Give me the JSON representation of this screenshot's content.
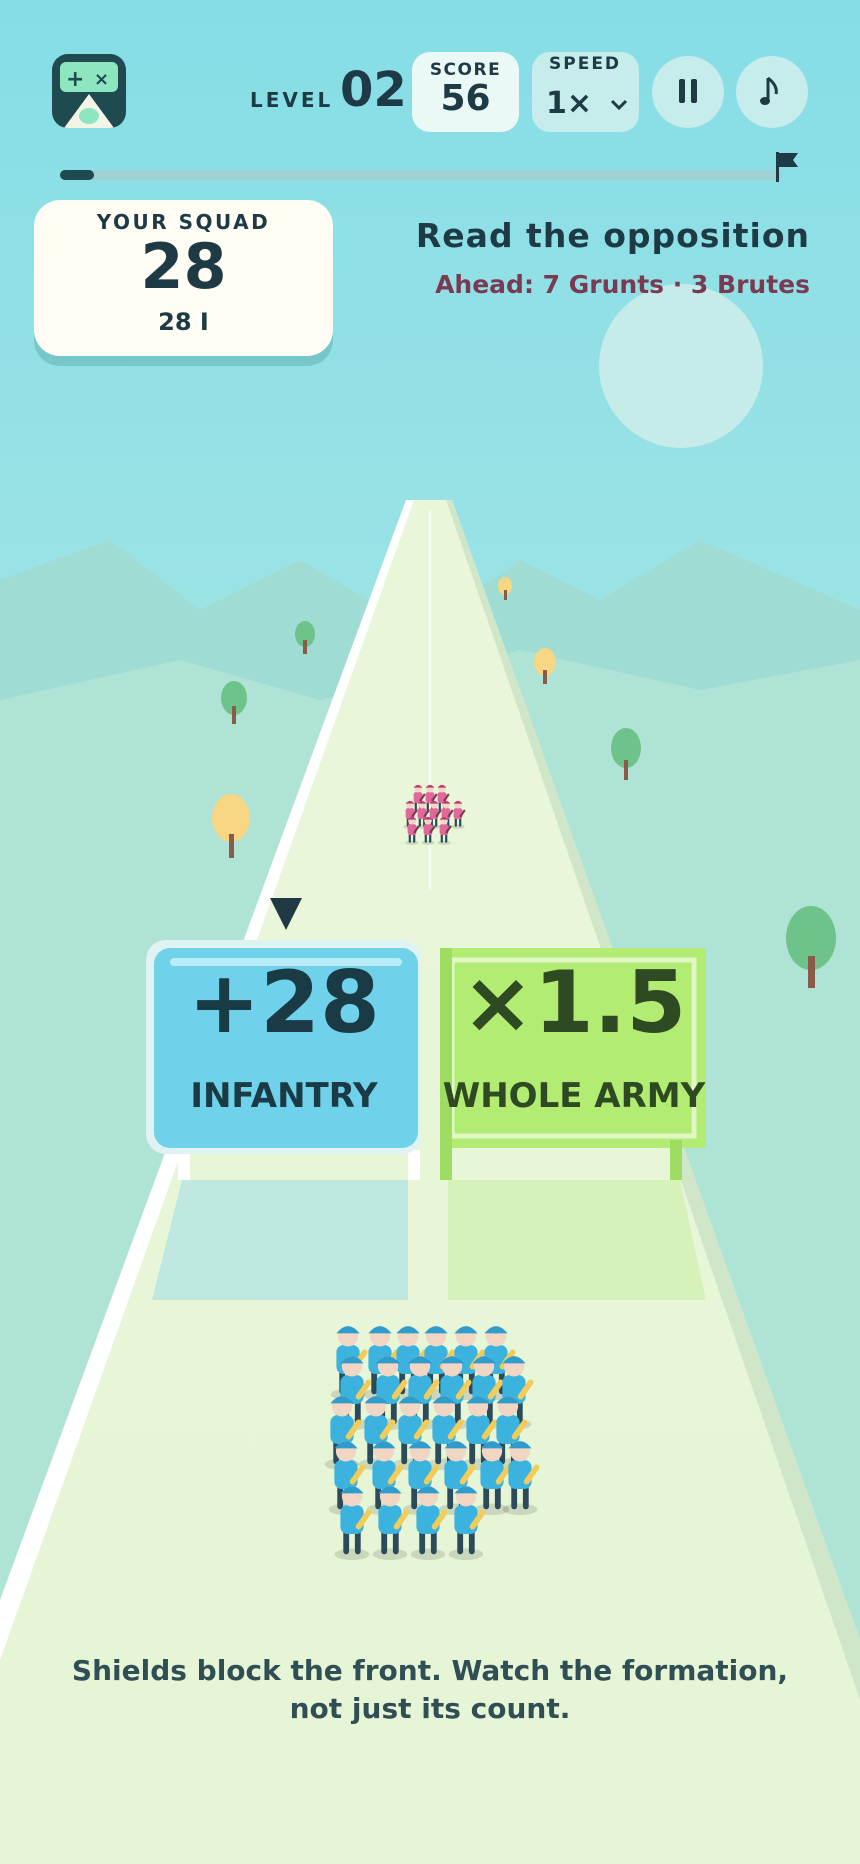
{
  "hud": {
    "level_label": "LEVEL",
    "level_value": "02",
    "score_label": "SCORE",
    "score_value": "56",
    "speed_label": "SPEED",
    "speed_value": "1×",
    "pause_icon": "pause-icon",
    "music_icon": "music-note-icon",
    "chevron_icon": "chevron-down-icon",
    "level_progress": 0.04,
    "goal_icon": "flag-icon"
  },
  "squad": {
    "label": "YOUR SQUAD",
    "count": "28",
    "breakdown": "28 I"
  },
  "objective": {
    "title": "Read the opposition",
    "subtitle": "Ahead: 7 Grunts · 3 Brutes"
  },
  "gates": {
    "left": {
      "value": "+28",
      "label": "INFANTRY",
      "color": "#6fd2ea",
      "selected": true
    },
    "right": {
      "value": "×1.5",
      "label": "WHOLE ARMY",
      "color": "#b2ec72"
    }
  },
  "hint": {
    "line1": "Shields block the front. Watch the formation,",
    "line2": "not just its count."
  },
  "colors": {
    "sky": "#86dde6",
    "road": "#e4f4d6",
    "ally_unit": "#3bb3de",
    "enemy_unit": "#e2689a",
    "dark": "#1f4a4f"
  },
  "army": {
    "ally_count": 28,
    "enemy_count": 10
  }
}
